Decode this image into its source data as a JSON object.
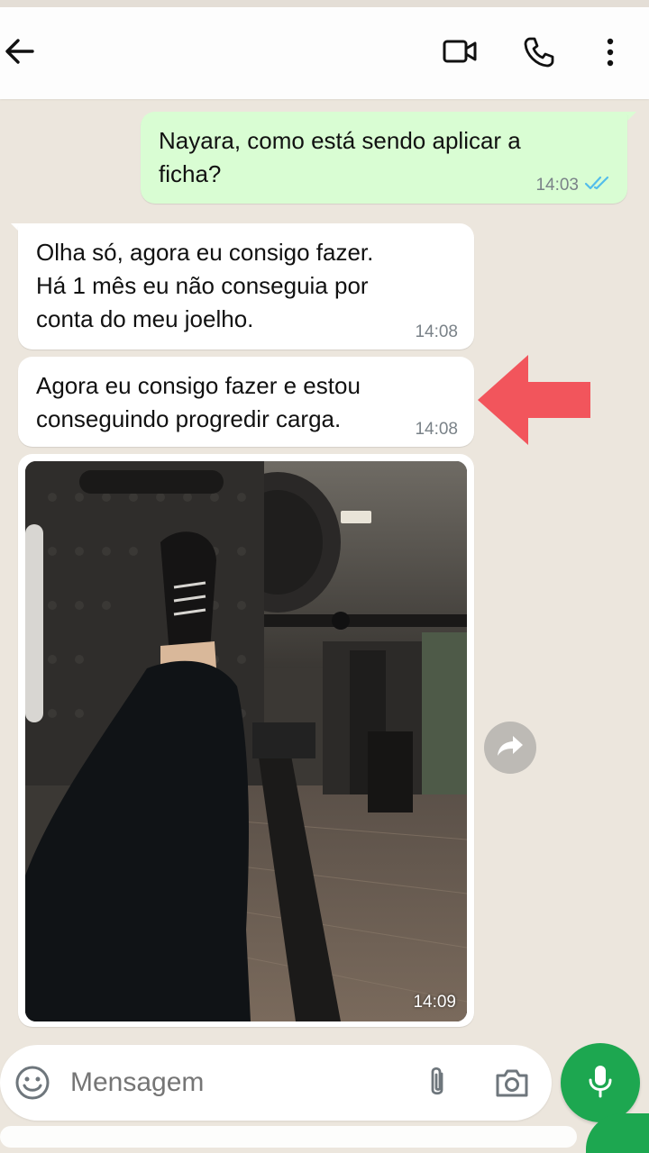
{
  "header": {
    "back_icon": "arrow-left-icon",
    "video_icon": "video-call-icon",
    "phone_icon": "phone-icon",
    "more_icon": "more-vertical-icon"
  },
  "messages": [
    {
      "direction": "out",
      "text_lines": [
        "Nayara, como está sendo aplicar a",
        "ficha?"
      ],
      "time": "14:03",
      "status": "read"
    },
    {
      "direction": "in",
      "text_lines": [
        "Olha só, agora eu consigo fazer.",
        "Há 1 mês eu não conseguia por",
        "conta do meu joelho."
      ],
      "time": "14:08"
    },
    {
      "direction": "in",
      "text_lines": [
        "Agora eu consigo fazer e estou",
        "conseguindo progredir carga."
      ],
      "time": "14:08"
    },
    {
      "direction": "in",
      "type": "image",
      "time": "14:09"
    }
  ],
  "composer": {
    "placeholder": "Mensagem",
    "emoji_icon": "emoji-icon",
    "attach_icon": "paperclip-icon",
    "camera_icon": "camera-icon",
    "mic_icon": "microphone-icon"
  },
  "colors": {
    "outgoing_bubble": "#d9fdd3",
    "incoming_bubble": "#ffffff",
    "chat_background": "#ece6dd",
    "read_ticks": "#53bdeb",
    "mic_button": "#1da750",
    "annotation_arrow": "#f2555c"
  }
}
